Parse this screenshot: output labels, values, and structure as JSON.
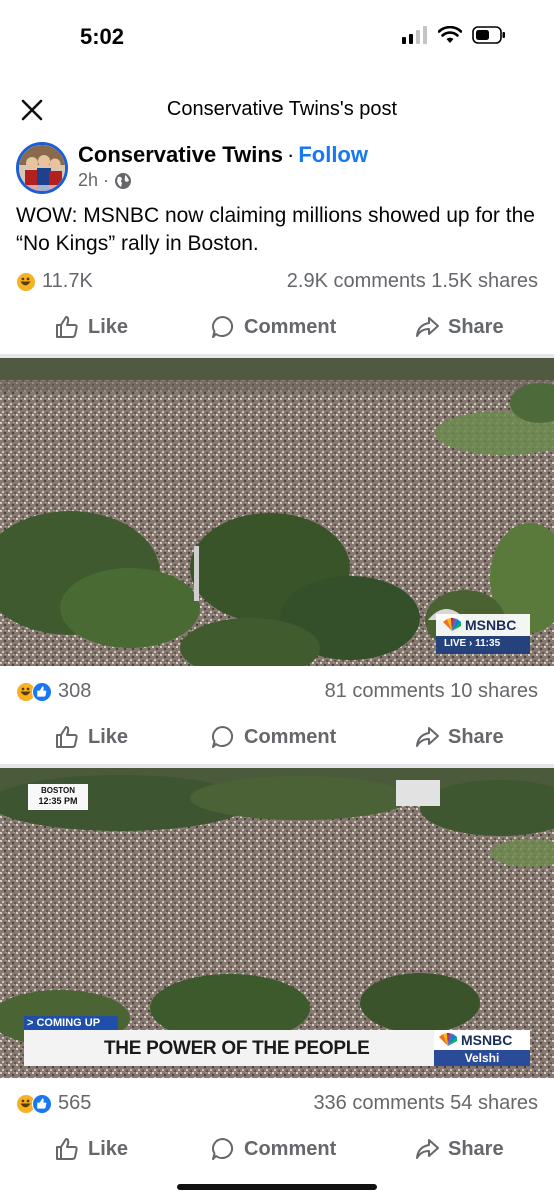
{
  "status_bar": {
    "time": "5:02"
  },
  "nav": {
    "title": "Conservative Twins's post"
  },
  "post": {
    "author": "Conservative Twins",
    "separator": "·",
    "follow": "Follow",
    "time": "2h",
    "dot": "·",
    "text": "WOW: MSNBC now claiming millions showed up for the “No Kings” rally in Boston.",
    "reactions": "11.7K",
    "comments_shares": "2.9K comments  1.5K shares"
  },
  "actions": {
    "like": "Like",
    "comment": "Comment",
    "share": "Share"
  },
  "photos": [
    {
      "logo": "MSNBC",
      "live": "LIVE › 11:35",
      "reactions": "308",
      "comments_shares": "81 comments  10 shares"
    },
    {
      "location": "BOSTON",
      "time": "12:35 PM",
      "coming_up": "> COMING UP",
      "headline": "THE POWER OF THE PEOPLE",
      "logo": "MSNBC",
      "show": "Velshi",
      "reactions": "565",
      "comments_shares": "336 comments  54 shares"
    }
  ],
  "colors": {
    "accent": "#1877f2",
    "meta": "#65676b",
    "divider": "#e4e6eb",
    "crowd": "#7a6e66",
    "trees": "#3f5a2e"
  }
}
